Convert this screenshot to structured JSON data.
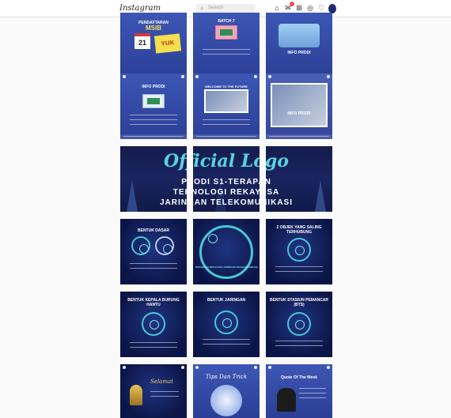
{
  "header": {
    "logo_text": "Instagram",
    "search_placeholder": "Search"
  },
  "nav": {
    "icons": [
      "home-icon",
      "messenger-icon",
      "new-post-icon",
      "explore-icon",
      "activity-icon",
      "profile-avatar"
    ]
  },
  "posts": {
    "r1c1": {
      "line1": "PENDAFTARAN",
      "line2": "MSIB",
      "date": "21",
      "sticker": "YUK"
    },
    "r1c2": {
      "line1": "BATCH 7"
    },
    "r1c3": {
      "line1": "INFO PRODI"
    },
    "r2c1": {
      "title": "INFO PRODI"
    },
    "r2c2": {
      "title": "WELCOME TO THE FUTURE"
    },
    "r2c3": {
      "title": "INFO PRODI"
    },
    "banner": {
      "title": "Official Logo",
      "line1": "PRODI S1-TERAPAN",
      "line2": "TEKNOLOGI REKAYASA",
      "line3": "JARINGAN TELEKOMUNIKASI"
    },
    "r4c1": {
      "title": "BENTUK DASAR"
    },
    "r4c2": {
      "ring_text": "TEKNOLOGI REKAYASA JARINGAN TELEKOMUNIKASI"
    },
    "r4c3": {
      "title": "2 OBJEK YANG SALING TERHUBUNG"
    },
    "r5c1": {
      "title": "BENTUK KEPALA BURUNG HANTU"
    },
    "r5c2": {
      "title": "BENTUK JARINGAN"
    },
    "r5c3": {
      "title": "BENTUK STASIUN PEMANCAR (BTS)"
    },
    "r6c1": {
      "title": "Selamat"
    },
    "r6c2": {
      "title": "Tips Dan Trick"
    },
    "r6c3": {
      "title": "Quote Of The Week"
    }
  },
  "colors": {
    "accent": "#48c8d4",
    "tile_blue": "#3d56b5",
    "tile_dark": "#0c1547",
    "notification": "#ed4956"
  }
}
